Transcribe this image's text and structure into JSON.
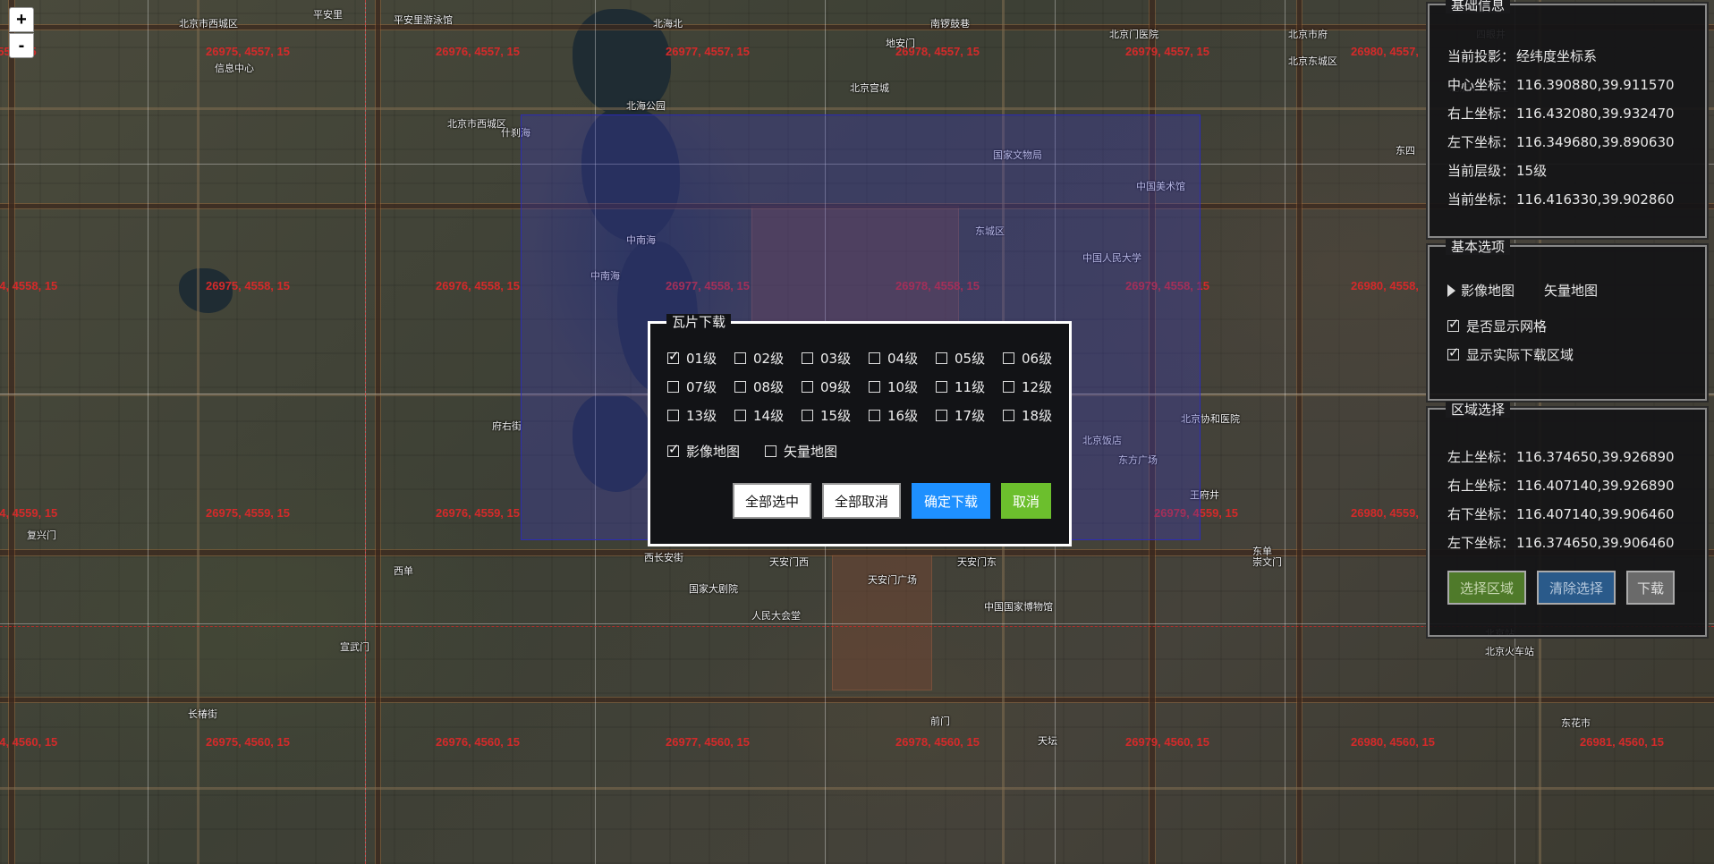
{
  "map": {
    "tile_labels": [
      "26975, 4557, 15",
      "26976, 4557, 15",
      "26977, 4557, 15",
      "26978, 4557, 15",
      "26979, 4557, 15",
      "26980, 4557,",
      "74, 4558, 15",
      "26975, 4558, 15",
      "26976, 4558, 15",
      "26977, 4558, 15",
      "26978, 4558, 15",
      "26979, 4558, 15",
      "26980, 4558,",
      "74, 4559, 15",
      "26975, 4559, 15",
      "26976, 4559, 15",
      "26979, 4559, 15",
      "26980, 4559,",
      "74, 4560, 15",
      "26975, 4560, 15",
      "26976, 4560, 15",
      "26977, 4560, 15",
      "26978, 4560, 15",
      "26979, 4560, 15",
      "26980, 4560, 15",
      "26981, 4560, 15",
      "4557, 15"
    ],
    "place_labels": [
      "北京市西城区",
      "平安里",
      "平安里游泳馆",
      "北海北",
      "中南海",
      "南锣鼓巷",
      "北京门医院",
      "北京市府",
      "北京东城区",
      "四眼井",
      "北京市东城区",
      "信息中心",
      "北京市西城区",
      "什刹海",
      "北海公园",
      "北京宫城",
      "地安门",
      "国家文物局",
      "东四",
      "中国美术馆",
      "中国人民大学",
      "东城区",
      "中南海",
      "天安门",
      "天安门广场",
      "王府井",
      "东单",
      "北京站",
      "前门",
      "天坛",
      "西单",
      "长椿街",
      "宣武门",
      "复兴门",
      "国家大剧院",
      "人民大会堂",
      "中国国家博物馆",
      "北京协和医院",
      "东方广场",
      "北京饭店",
      "天安门东",
      "天安门西",
      "府右街",
      "西长安街",
      "崇文门",
      "北京火车站",
      "东花市"
    ]
  },
  "zoom": {
    "in_label": "+",
    "out_label": "-"
  },
  "basic_info": {
    "title": "基础信息",
    "projection_key": "当前投影：",
    "projection_val": "经纬度坐标系",
    "center_key": "中心坐标：",
    "center_val": "116.390880,39.911570",
    "top_right_key": "右上坐标：",
    "top_right_val": "116.432080,39.932470",
    "bottom_left_key": "左下坐标：",
    "bottom_left_val": "116.349680,39.890630",
    "level_key": "当前层级：",
    "level_val": "15级",
    "current_key": "当前坐标：",
    "current_val": "116.416330,39.902860"
  },
  "basic_options": {
    "title": "基本选项",
    "imagery_label": "影像地图",
    "vector_label": "矢量地图",
    "show_grid_label": "是否显示网格",
    "show_area_label": "显示实际下载区域"
  },
  "region": {
    "title": "区域选择",
    "top_left_key": "左上坐标：",
    "top_left_val": "116.374650,39.926890",
    "top_right_key": "右上坐标：",
    "top_right_val": "116.407140,39.926890",
    "bottom_right_key": "右下坐标：",
    "bottom_right_val": "116.407140,39.906460",
    "bottom_left_key": "左下坐标：",
    "bottom_left_val": "116.374650,39.906460",
    "select_btn": "选择区域",
    "clear_btn": "清除选择",
    "download_btn": "下载"
  },
  "dialog": {
    "title": "瓦片下载",
    "levels": [
      "01级",
      "02级",
      "03级",
      "04级",
      "05级",
      "06级",
      "07级",
      "08级",
      "09级",
      "10级",
      "11级",
      "12级",
      "13级",
      "14级",
      "15级",
      "16级",
      "17级",
      "18级"
    ],
    "imagery_label": "影像地图",
    "vector_label": "矢量地图",
    "select_all": "全部选中",
    "cancel_all": "全部取消",
    "confirm": "确定下载",
    "cancel": "取消"
  },
  "colors": {
    "tile_label": "#d42a2a",
    "confirm_btn": "#1e90ff",
    "cancel_btn": "#6cbf2d",
    "select_btn": "#4f7a2a",
    "clear_btn": "#2a5a8a",
    "download_btn": "#6a6a6a"
  }
}
